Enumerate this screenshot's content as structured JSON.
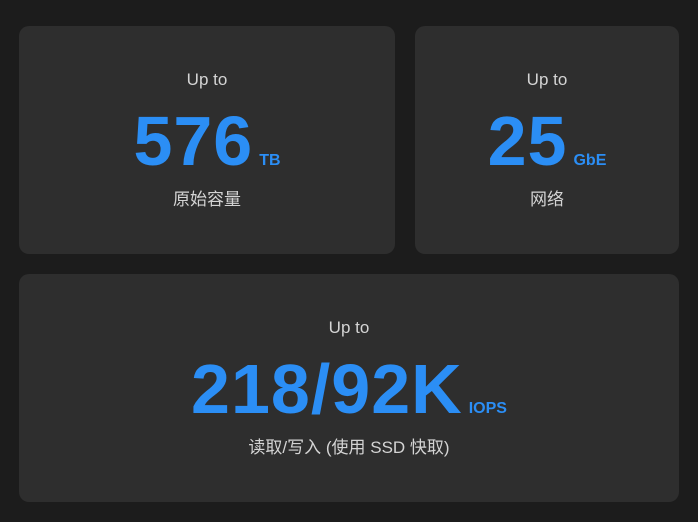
{
  "cards": [
    {
      "prefix": "Up to",
      "value": "576",
      "unit": "TB",
      "caption": "原始容量"
    },
    {
      "prefix": "Up to",
      "value": "25",
      "unit": "GbE",
      "caption": "网络"
    },
    {
      "prefix": "Up to",
      "value": "218/92K",
      "unit": "IOPS",
      "caption": "读取/写入 (使用 SSD 快取)"
    }
  ],
  "colors": {
    "background": "#1c1c1c",
    "card": "#2e2e2e",
    "accent": "#2b8ef5",
    "text": "#d4d4d4"
  }
}
